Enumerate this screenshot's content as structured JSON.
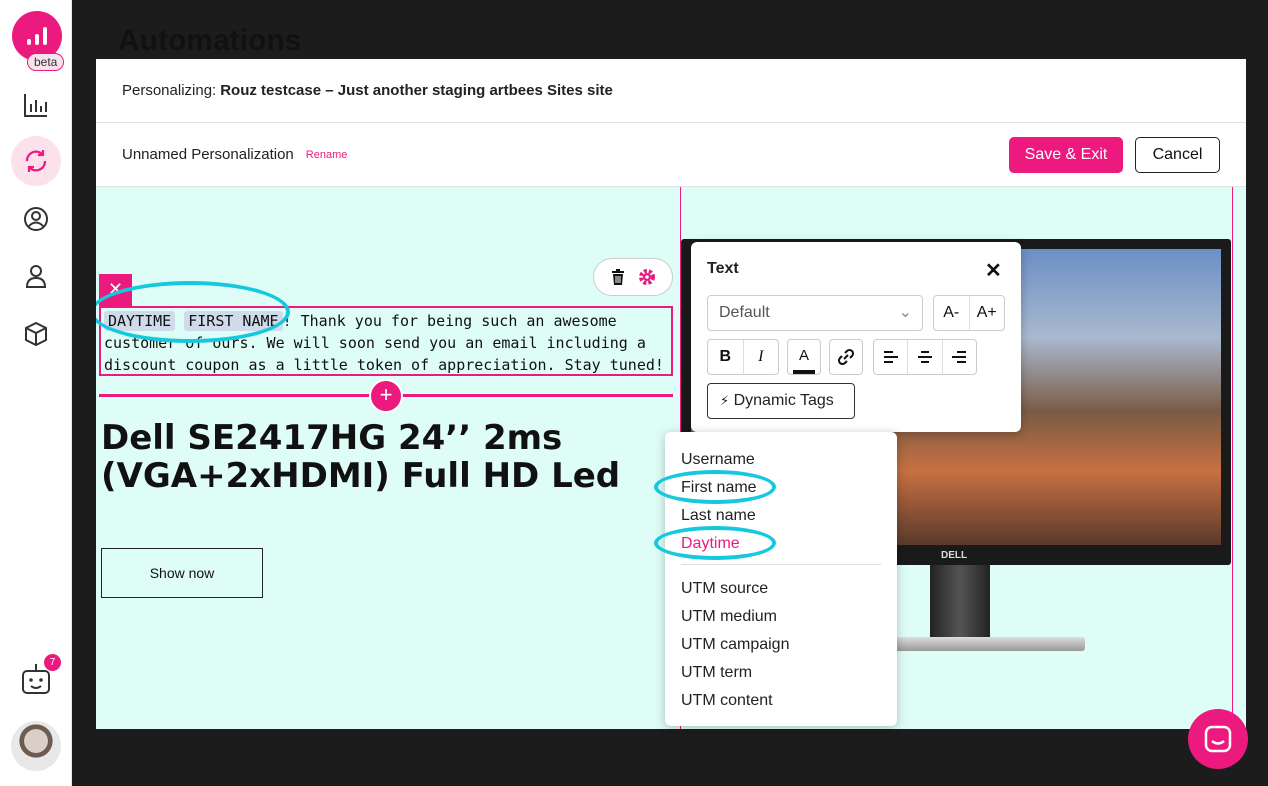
{
  "app": {
    "background_title": "Automations",
    "beta_label": "beta",
    "bot_badge_count": "7"
  },
  "colors": {
    "accent": "#ec1a7e",
    "canvas_bg": "#dffdf7",
    "highlight": "#16c8dd"
  },
  "modal": {
    "header_prefix": "Personalizing:",
    "site_name": "Rouz testcase – Just another staging artbees Sites site",
    "personalization_name": "Unnamed Personalization",
    "rename_label": "Rename",
    "save_label": "Save & Exit",
    "cancel_label": "Cancel"
  },
  "editor": {
    "tag_daytime": "DAYTIME",
    "tag_first_name": "FIRST NAME",
    "body_text": "! Thank you for being such an awesome customer of ours. We will soon send you an email including a discount coupon as a little token of appreciation. Stay tuned!",
    "close_glyph": "✕",
    "plus_glyph": "+",
    "headline": "Dell SE2417HG 24’’ 2ms (VGA+2xHDMI) Full HD Led",
    "cta_label": "Show now",
    "monitor_brand": "DELL"
  },
  "text_popup": {
    "title": "Text",
    "close_glyph": "✕",
    "font_select_value": "Default",
    "font_decrease": "A-",
    "font_increase": "A+",
    "bold": "B",
    "italic": "I",
    "color": "A",
    "dynamic_tags_label": "Dynamic Tags"
  },
  "dynamic_tags": {
    "items": [
      "Username",
      "First name",
      "Last name",
      "Daytime"
    ],
    "utm_items": [
      "UTM source",
      "UTM medium",
      "UTM campaign",
      "UTM term",
      "UTM content"
    ],
    "active": "Daytime"
  }
}
